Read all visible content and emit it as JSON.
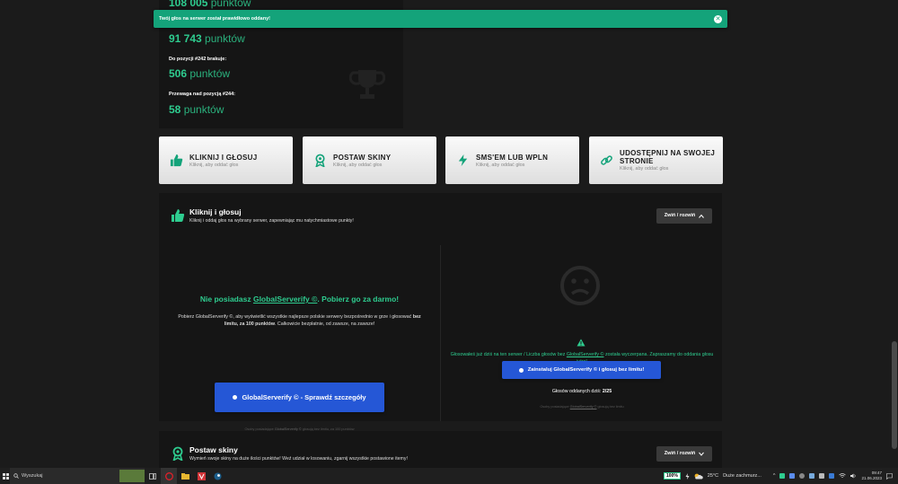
{
  "stats": {
    "row0_value": "108 005",
    "row0_unit": "punktów",
    "row1_value": "91 743",
    "row1_unit": "punktów",
    "missing_label": "Do pozycji #242 brakuje:",
    "missing_value": "506",
    "missing_unit": "punktów",
    "lead_label": "Przewaga nad pozycją #244:",
    "lead_value": "58",
    "lead_unit": "punktów"
  },
  "toast": {
    "message": "Twój głos na serwer został prawidłowo oddany!",
    "close": "✕"
  },
  "cards": [
    {
      "title": "KLIKNIJ I GŁOSUJ",
      "sub": "Kliknij, aby oddać głos",
      "icon": "thumbs-up-icon"
    },
    {
      "title": "POSTAW SKINY",
      "sub": "Kliknij, aby oddać głos",
      "icon": "award-icon"
    },
    {
      "title": "SMS'EM LUB WPLN",
      "sub": "Kliknij, aby oddać głos",
      "icon": "lightning-icon"
    },
    {
      "title": "UDOSTĘPNIJ NA SWOJEJ STRONIE",
      "sub": "Kliknij, aby oddać głos",
      "icon": "link-icon"
    }
  ],
  "section1": {
    "title": "Kliknij i głosuj",
    "subtitle": "Kliknij i oddaj głos na wybrany serwer, zapewniając mu natychmiastowe punkty!",
    "toggle": "Zwiń / rozwiń",
    "promo_prefix": "Nie posiadasz",
    "promo_link": "GlobalServerify ©",
    "promo_suffix": ". Pobierz go za darmo!",
    "promo_desc_1": "Pobierz GlobalServerify ©, aby wyświetlić wszystkie najlepsze polskie serwery bezpośrednio w grze i głosować",
    "promo_desc_bold": "bez limitu, za 100 punktów",
    "promo_desc_2": ". Całkowicie bezpłatnie, od zawsze, na zawsze!",
    "promo_button": "GlobalServerify © - Sprawdź szczegóły",
    "promo_fine_1": "Osoby posiadające",
    "promo_fine_link": "GlobalServerify ©",
    "promo_fine_2": "głosują bez limitu, za 100 punktów",
    "warn_1": "Głosowałeś już dziś na ten serwer / Liczba głosów bez",
    "warn_link": "GlobalServerify ©",
    "warn_2": "została wyczerpana. Zapraszamy do oddania głosu jutro!",
    "install_button": "Zainstaluj GlobalServerify © i głosuj bez limitu!",
    "votes_label": "Głosów oddanych dziś:",
    "votes_value": "2/25",
    "right_fine_1": "Osoby posiadające",
    "right_fine_link": "GlobalServerify ©",
    "right_fine_2": "głosują bez limitu"
  },
  "section2": {
    "title": "Postaw skiny",
    "subtitle": "Wymień swoje skiny na duże ilości punktów! Weź udział w losowaniu, zgarnij wszystkie postawione itemy!",
    "toggle": "Zwiń / rozwiń"
  },
  "taskbar": {
    "search": "Wyszukaj",
    "battery": "100%",
    "weather_temp": "25°C",
    "weather_desc": "Duże zachmurz...",
    "time": "09:47",
    "date": "21.06.2023"
  },
  "colors": {
    "accent_green": "#2ecc8f",
    "toast_green": "#14a37a",
    "button_blue": "#2557d6",
    "background": "#1b1b1b",
    "panel": "#151515"
  }
}
